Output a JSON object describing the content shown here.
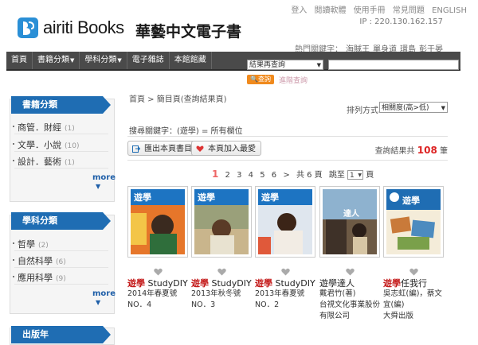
{
  "header": {
    "brand": "airiti Books",
    "brand_cn": "華藝中文電子書",
    "top_links": [
      "登入",
      "閱讀軟體",
      "使用手冊",
      "常見問題",
      "ENGLISH"
    ],
    "ip": "IP : 220.130.162.157",
    "hot_label": "熱門關鍵字：",
    "hot_tags": [
      "海賊王",
      "單身道",
      "環島",
      "彭于晏"
    ]
  },
  "nav": {
    "items": [
      "首頁",
      "書籍分類",
      "學科分類",
      "電子雜誌",
      "本館館藏"
    ]
  },
  "search": {
    "scope": "結果再查詢",
    "placeholder": "",
    "button": "查詢",
    "advanced": "進階查詢"
  },
  "sidebar": {
    "books_title": "書籍分類",
    "books": [
      {
        "label": "商管．財經",
        "count": "(1)"
      },
      {
        "label": "文學．小說",
        "count": "(10)"
      },
      {
        "label": "設計．藝術",
        "count": "(1)"
      }
    ],
    "more": "more",
    "subjects_title": "學科分類",
    "subjects": [
      {
        "label": "哲學",
        "count": "(2)"
      },
      {
        "label": "自然科學",
        "count": "(6)"
      },
      {
        "label": "應用科學",
        "count": "(9)"
      }
    ],
    "third_title": "出版年"
  },
  "main": {
    "breadcrumb": "首頁 > 簡目頁(查詢結果頁)",
    "sort_label": "排列方式",
    "sort_value": "相關度(高>低)",
    "query": "搜尋關鍵字：(遊學) = 所有欄位",
    "export_btn": "匯出本頁書目",
    "fav_btn": "本頁加入最愛",
    "result_prefix": "查詢結果共",
    "result_count": "108",
    "result_suffix": "筆",
    "pages": [
      "1",
      "2",
      "3",
      "4",
      "5",
      "6"
    ],
    "next": ">",
    "total_pages": "共 6 頁",
    "jump_label": "跳至",
    "jump_value": "1",
    "page_suffix": "頁"
  },
  "books": [
    {
      "title_red": "遊學",
      "title_rest": " StudyDIY",
      "sub": "2014年春夏號NO．4"
    },
    {
      "title_red": "遊學",
      "title_rest": " StudyDIY",
      "sub": "2013年秋冬號NO．3"
    },
    {
      "title_red": "遊學",
      "title_rest": " StudyDIY",
      "sub": "2013年春夏號NO．2"
    },
    {
      "title_red": "",
      "title_rest": "遊學達人",
      "sub": "戴君竹(著)\n台視文化事業股份有限公司"
    },
    {
      "title_red": "遊學",
      "title_rest": "任我行",
      "sub": "吳志虹(編)，蔡文宜(編)\n大舜出版"
    }
  ],
  "colors": {
    "accent": "#1f6db3",
    "nav": "#4a4a4a",
    "highlight": "#c41a1a",
    "search_btn": "#f08a1d"
  }
}
